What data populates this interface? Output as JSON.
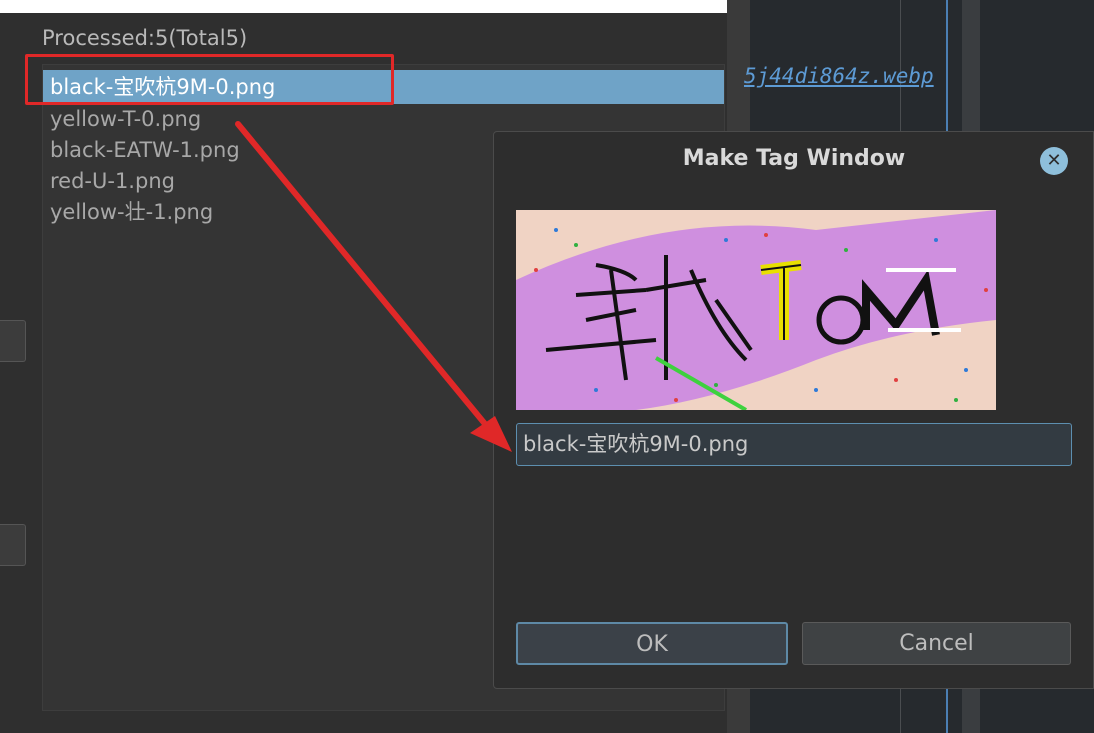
{
  "background": {
    "link_text": "5j44di864z.webp"
  },
  "file_panel": {
    "processed_label": "Processed:5(Total5)",
    "files": [
      {
        "name": "black-宝吹杭9M-0.png",
        "selected": true
      },
      {
        "name": "yellow-T-0.png",
        "selected": false
      },
      {
        "name": "black-EATW-1.png",
        "selected": false
      },
      {
        "name": "red-U-1.png",
        "selected": false
      },
      {
        "name": "yellow-壮-1.png",
        "selected": false
      }
    ]
  },
  "dialog": {
    "title": "Make Tag Window",
    "close_icon": "close-icon",
    "tag_value": "black-宝吹杭9M-0.png",
    "ok_label": "OK",
    "cancel_label": "Cancel"
  },
  "colors": {
    "selection": "#6fa3c7",
    "annotation": "#e02828",
    "captcha_pink": "#cf8fdf",
    "captcha_peach": "#f0d3c4"
  }
}
